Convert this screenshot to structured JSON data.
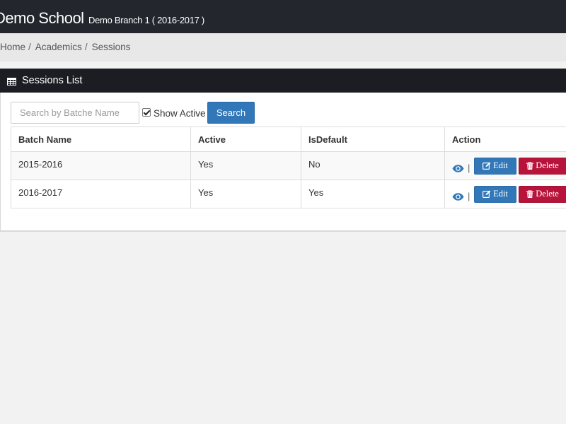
{
  "header": {
    "brand": "Demo School",
    "branch": "Demo Branch 1 ( 2016-2017 )"
  },
  "breadcrumb": [
    {
      "label": "Home"
    },
    {
      "label": "Academics"
    },
    {
      "label": "Sessions"
    }
  ],
  "panel": {
    "title": "Sessions List",
    "icon": "table-icon"
  },
  "filters": {
    "search_placeholder": "Search by Batche Name",
    "search_value": "",
    "show_active_label": "Show Active",
    "show_active_checked": true,
    "search_button": "Search"
  },
  "table": {
    "columns": [
      "Batch Name",
      "Active",
      "IsDefault",
      "Action"
    ],
    "rows": [
      {
        "batch": "2015-2016",
        "active": "Yes",
        "is_default": "No"
      },
      {
        "batch": "2016-2017",
        "active": "Yes",
        "is_default": "Yes"
      }
    ],
    "actions": {
      "view_icon": "eye-icon",
      "separator": "|",
      "edit_label": "Edit",
      "edit_icon": "edit-icon",
      "delete_label": "Delete",
      "delete_icon": "trash-icon"
    }
  },
  "colors": {
    "topbar": "#23262d",
    "panel_heading": "#1b1d23",
    "primary": "#3277b8",
    "danger": "#b8133a"
  }
}
